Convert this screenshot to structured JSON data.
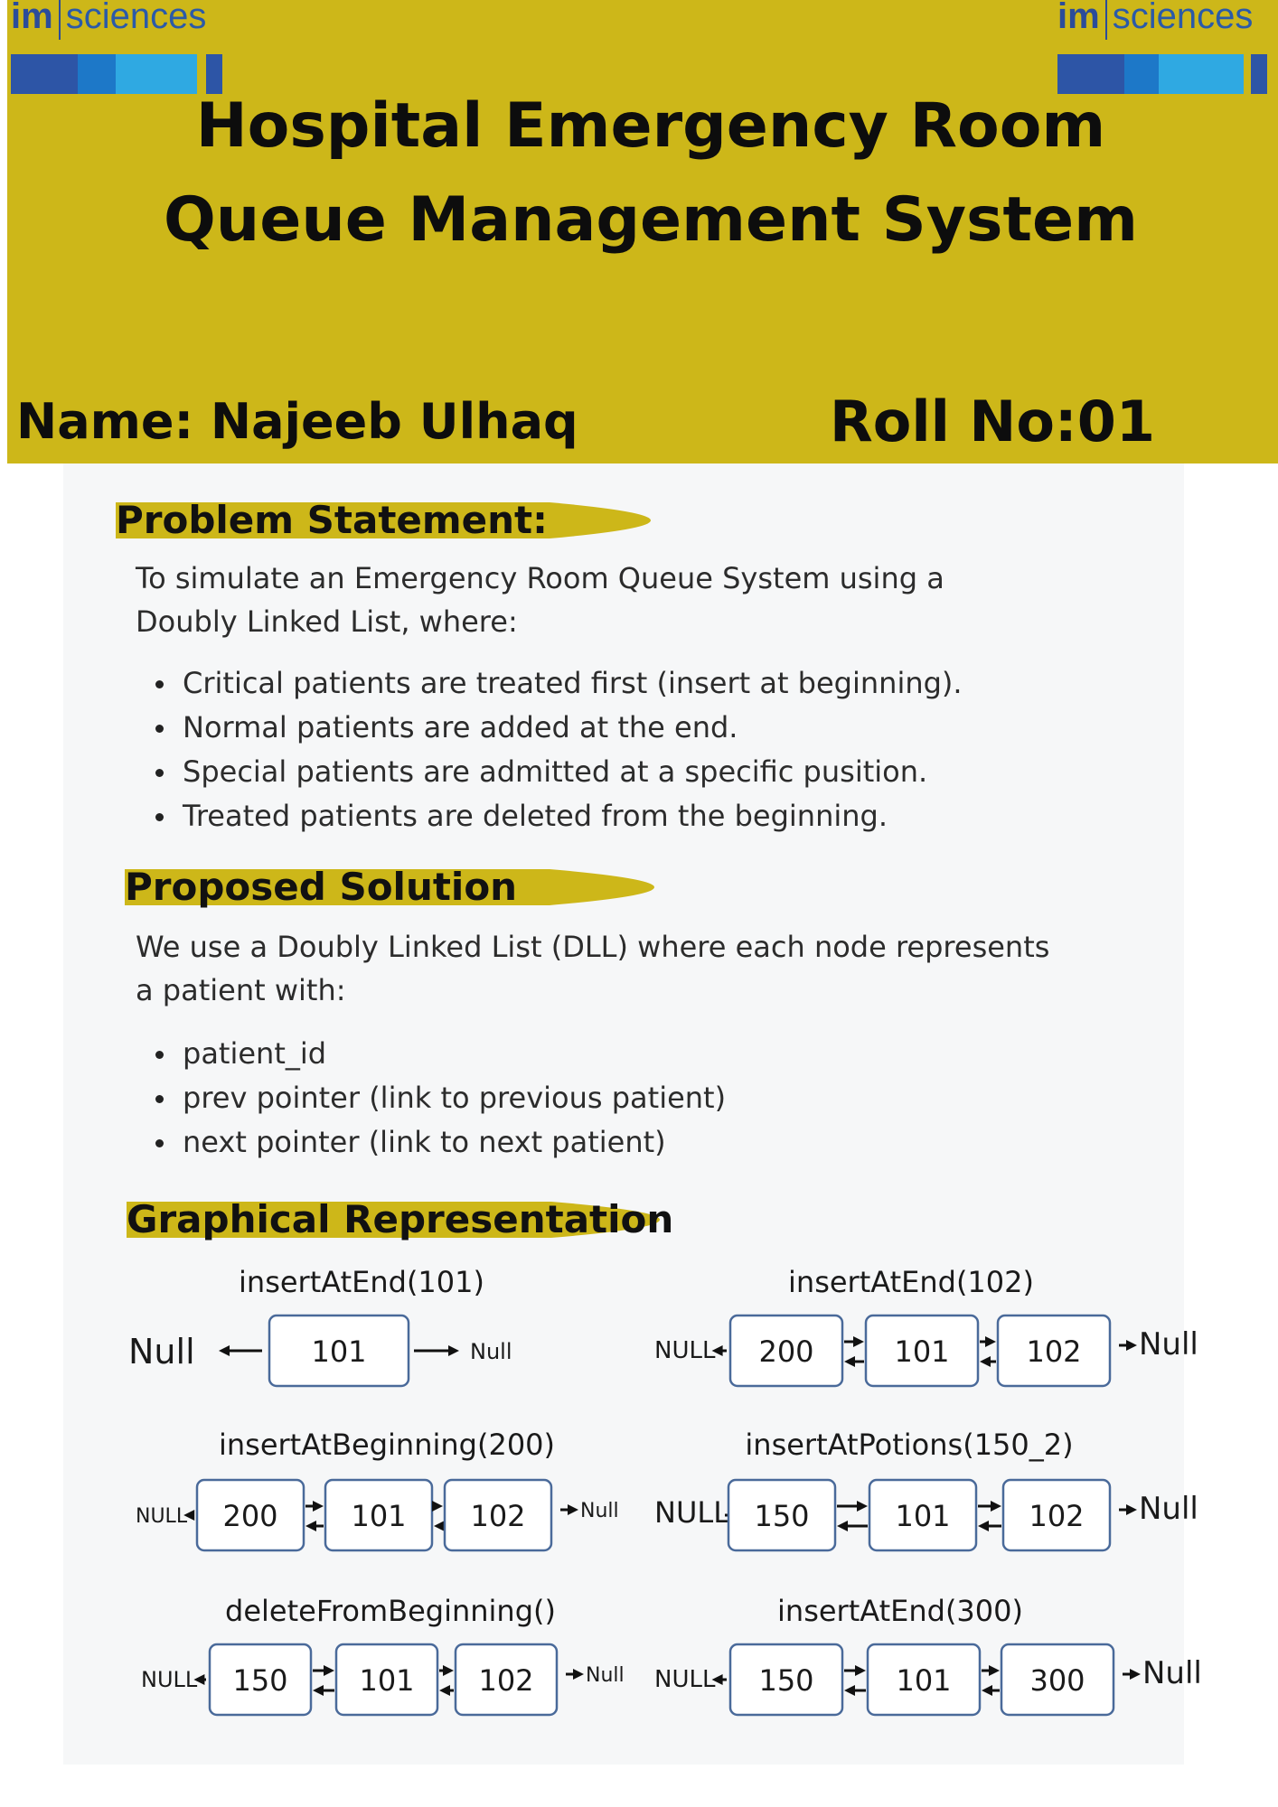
{
  "logo": {
    "mark": "im",
    "text": "sciences"
  },
  "header": {
    "title_line1": "Hospital Emergency Room",
    "title_line2": "Queue Management System",
    "name": "Name: Najeeb Ulhaq",
    "roll": "Roll No:01"
  },
  "problem": {
    "heading": "Problem Statement:",
    "intro_line1": "To simulate an Emergency Room Queue System using a",
    "intro_line2": "Doubly Linked List, where:",
    "bullets": [
      "Critical patients are treated first (insert at beginning).",
      "Normal patients are added at the end.",
      "Special patients are admitted at a specific pusition.",
      "Treated patients are deleted from the beginning."
    ]
  },
  "solution": {
    "heading": "Proposed Solution",
    "intro_line1": "We use a Doubly Linked List (DLL) where each node represents",
    "intro_line2": "a patient with:",
    "bullets": [
      "patient_id",
      "prev pointer  (link to previous patient)",
      "next pointer (link to next patient)"
    ]
  },
  "graphical": {
    "heading": "Graphical Representation",
    "diagrams": [
      {
        "op": "insertAtEnd(101)",
        "left": "Null",
        "nodes": [
          "101"
        ],
        "right": "Null"
      },
      {
        "op": "insertAtEnd(102)",
        "left": "NULL",
        "nodes": [
          "200",
          "101",
          "102"
        ],
        "right": "Null"
      },
      {
        "op": "insertAtBeginning(200)",
        "left": "NULL",
        "nodes": [
          "200",
          "101",
          "102"
        ],
        "right": "Null"
      },
      {
        "op": "insertAtPotions(150_2)",
        "left": "NULL",
        "nodes": [
          "150",
          "101",
          "102"
        ],
        "right": "Null"
      },
      {
        "op": "deleteFromBeginning()",
        "left": "NULL",
        "nodes": [
          "150",
          "101",
          "102"
        ],
        "right": "Null"
      },
      {
        "op": "insertAtEnd(300)",
        "left": "NULL",
        "nodes": [
          "150",
          "101",
          "300"
        ],
        "right": "Null"
      }
    ]
  },
  "colors": {
    "header_bg": "#cdb719",
    "swoosh": "#cdb719",
    "logo_blue": "#2b4c9a",
    "node_border": "#4a6a9a"
  }
}
